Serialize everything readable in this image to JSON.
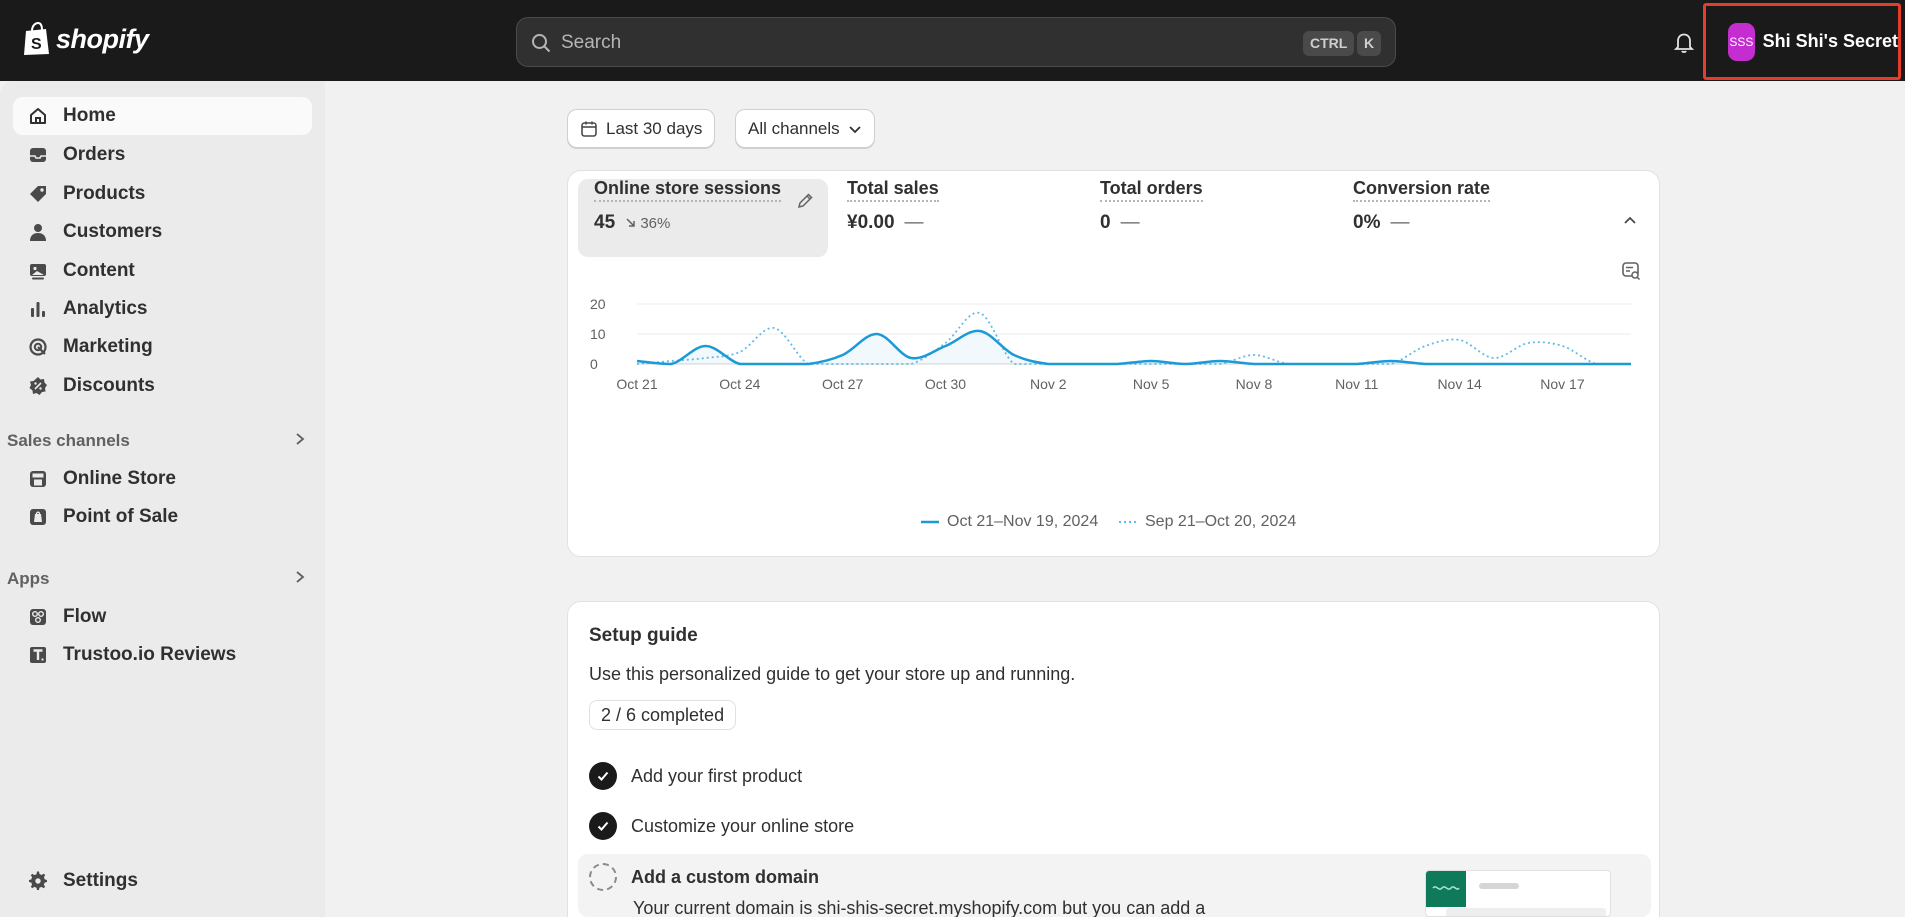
{
  "topbar": {
    "logo_text": "shopify",
    "search_placeholder": "Search",
    "shortcut_ctrl": "CTRL",
    "shortcut_k": "K",
    "store_initials": "SSS",
    "store_name": "Shi Shi's Secret"
  },
  "sidebar": {
    "main_items": [
      {
        "label": "Home",
        "icon": "home-icon"
      },
      {
        "label": "Orders",
        "icon": "inbox-icon"
      },
      {
        "label": "Products",
        "icon": "tag-icon"
      },
      {
        "label": "Customers",
        "icon": "person-icon"
      },
      {
        "label": "Content",
        "icon": "image-icon"
      },
      {
        "label": "Analytics",
        "icon": "bar-chart-icon"
      },
      {
        "label": "Marketing",
        "icon": "target-icon"
      },
      {
        "label": "Discounts",
        "icon": "discount-icon"
      }
    ],
    "sales_channels_label": "Sales channels",
    "sales_channels": [
      {
        "label": "Online Store",
        "icon": "store-icon"
      },
      {
        "label": "Point of Sale",
        "icon": "pos-icon"
      }
    ],
    "apps_label": "Apps",
    "apps": [
      {
        "label": "Flow",
        "icon": "flow-icon"
      },
      {
        "label": "Trustoo.io Reviews",
        "icon": "trustoo-icon"
      }
    ],
    "settings_label": "Settings"
  },
  "filters": {
    "date_range": "Last 30 days",
    "channels": "All channels"
  },
  "metrics": [
    {
      "title": "Online store sessions",
      "value": "45",
      "delta": "36%"
    },
    {
      "title": "Total sales",
      "value": "¥0.00",
      "delta": "—"
    },
    {
      "title": "Total orders",
      "value": "0",
      "delta": "—"
    },
    {
      "title": "Conversion rate",
      "value": "0%",
      "delta": "—"
    }
  ],
  "legend": {
    "current": "Oct 21–Nov 19, 2024",
    "previous": "Sep 21–Oct 20, 2024"
  },
  "chart_data": {
    "type": "line",
    "x": [
      "Oct 21",
      "Oct 22",
      "Oct 23",
      "Oct 24",
      "Oct 25",
      "Oct 26",
      "Oct 27",
      "Oct 28",
      "Oct 29",
      "Oct 30",
      "Oct 31",
      "Nov 1",
      "Nov 2",
      "Nov 3",
      "Nov 4",
      "Nov 5",
      "Nov 6",
      "Nov 7",
      "Nov 8",
      "Nov 9",
      "Nov 10",
      "Nov 11",
      "Nov 12",
      "Nov 13",
      "Nov 14",
      "Nov 15",
      "Nov 16",
      "Nov 17",
      "Nov 18",
      "Nov 19"
    ],
    "xticks": [
      "Oct 21",
      "Oct 24",
      "Oct 27",
      "Oct 30",
      "Nov 2",
      "Nov 5",
      "Nov 8",
      "Nov 11",
      "Nov 14",
      "Nov 17"
    ],
    "yticks": [
      "0",
      "10",
      "20"
    ],
    "ylim": [
      0,
      20
    ],
    "series": [
      {
        "name": "Oct 21–Nov 19, 2024",
        "style": "solid",
        "color": "#1b9ad7",
        "values": [
          1,
          0,
          6,
          0,
          0,
          0,
          3,
          10,
          2,
          6,
          11,
          3,
          0,
          0,
          0,
          1,
          0,
          1,
          0,
          0,
          0,
          0,
          1,
          0,
          0,
          0,
          0,
          0,
          0,
          0
        ]
      },
      {
        "name": "Sep 21–Oct 20, 2024",
        "style": "dotted",
        "color": "#5fbde6",
        "values": [
          0,
          1,
          2,
          4,
          12,
          0,
          0,
          0,
          0,
          7,
          17,
          0,
          0,
          0,
          0,
          0,
          0,
          0,
          3,
          0,
          0,
          0,
          0,
          6,
          8,
          2,
          7,
          6,
          0,
          0
        ]
      }
    ]
  },
  "setup": {
    "title": "Setup guide",
    "subtitle": "Use this personalized guide to get your store up and running.",
    "progress": "2 / 6 completed",
    "tasks": [
      {
        "label": "Add your first product",
        "done": true
      },
      {
        "label": "Customize your online store",
        "done": true
      },
      {
        "label": "Add a custom domain",
        "done": false
      }
    ],
    "domain_desc": "Your current domain is shi-shis-secret.myshopify.com but you can add a"
  }
}
